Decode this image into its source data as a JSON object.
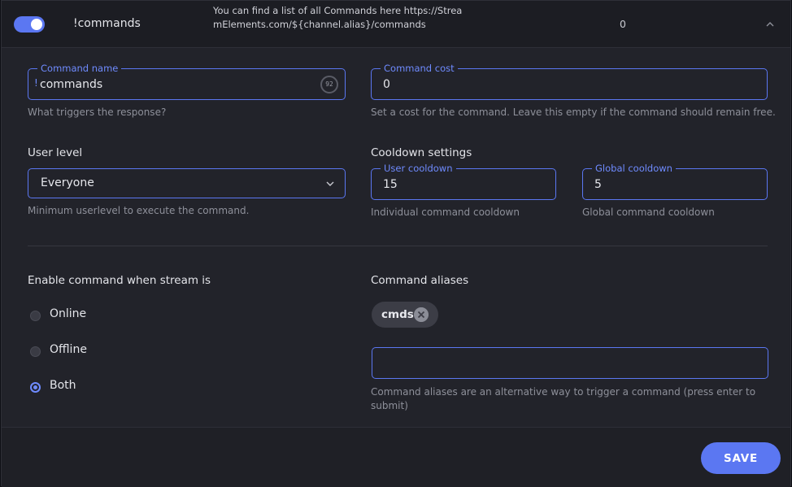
{
  "header": {
    "enabled": true,
    "command_name": "!commands",
    "response": "You can find a list of all Commands here https://StreamElements.com/${channel.alias}/commands",
    "cost": "0"
  },
  "command_name_field": {
    "label": "Command name",
    "prefix": "!",
    "value": "commands",
    "remaining_chars": "92",
    "helper": "What triggers the response?"
  },
  "command_cost_field": {
    "label": "Command cost",
    "value": "0",
    "helper": "Set a cost for the command. Leave this empty if the command should remain free."
  },
  "user_level": {
    "title": "User level",
    "selected": "Everyone",
    "helper": "Minimum userlevel to execute the command."
  },
  "cooldown": {
    "title": "Cooldown settings",
    "user_label": "User cooldown",
    "user_value": "15",
    "user_helper": "Individual command cooldown",
    "global_label": "Global cooldown",
    "global_value": "5",
    "global_helper": "Global command cooldown"
  },
  "stream_state": {
    "title": "Enable command when stream is",
    "options": [
      "Online",
      "Offline",
      "Both"
    ],
    "selected": "Both"
  },
  "aliases": {
    "title": "Command aliases",
    "items": [
      "cmds"
    ],
    "input_value": "",
    "helper": "Command aliases are an alternative way to trigger a command (press enter to submit)"
  },
  "footer": {
    "save_label": "SAVE"
  },
  "colors": {
    "accent": "#5b77f2",
    "panel": "#22232a",
    "text": "#e4e5ea",
    "muted": "#8e909a"
  }
}
